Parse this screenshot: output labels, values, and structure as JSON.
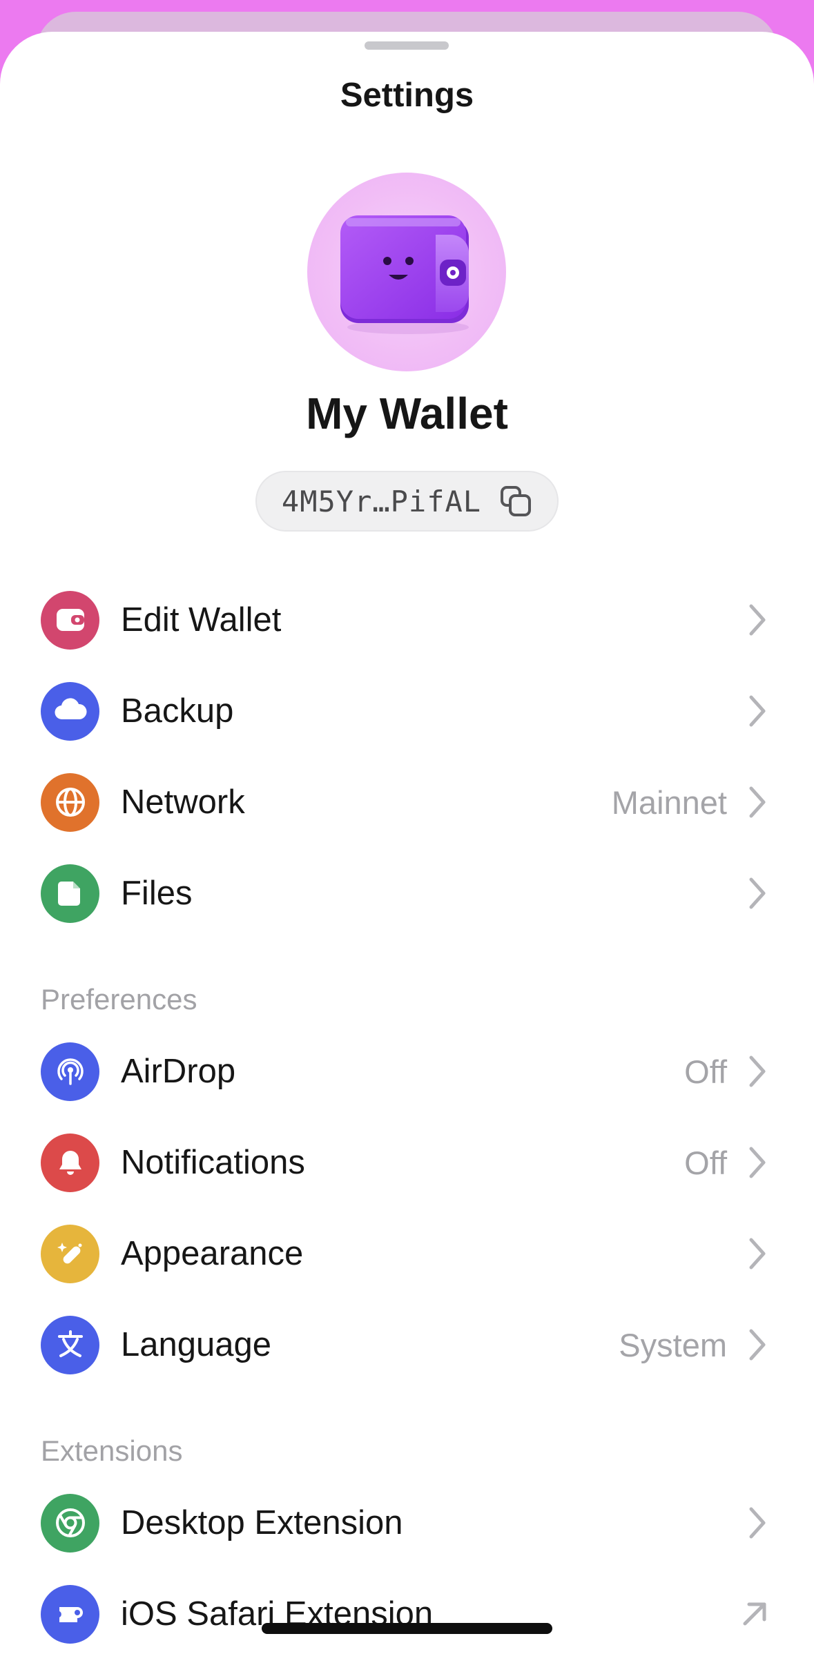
{
  "header": {
    "title": "Settings"
  },
  "profile": {
    "name": "My Wallet",
    "address": "4M5Yr…PifAL",
    "avatar_icon": "wallet-mascot-icon",
    "copy_icon": "copy-icon"
  },
  "colors": {
    "background": "#ec7af0",
    "sheet": "#ffffff",
    "accent_purple": "#9a3cf0"
  },
  "wallet_section": {
    "items": [
      {
        "label": "Edit Wallet",
        "value": "",
        "icon": "wallet-icon",
        "color": "#d2466e"
      },
      {
        "label": "Backup",
        "value": "",
        "icon": "cloud-icon",
        "color": "#4a5fe8"
      },
      {
        "label": "Network",
        "value": "Mainnet",
        "icon": "globe-icon",
        "color": "#e0722c"
      },
      {
        "label": "Files",
        "value": "",
        "icon": "file-icon",
        "color": "#3fa462"
      }
    ]
  },
  "preferences": {
    "heading": "Preferences",
    "items": [
      {
        "label": "AirDrop",
        "value": "Off",
        "icon": "airdrop-icon",
        "color": "#4a5fe8"
      },
      {
        "label": "Notifications",
        "value": "Off",
        "icon": "bell-icon",
        "color": "#dc4a4a"
      },
      {
        "label": "Appearance",
        "value": "",
        "icon": "magic-wand-icon",
        "color": "#e6b53c"
      },
      {
        "label": "Language",
        "value": "System",
        "icon": "translate-icon",
        "color": "#4a5fe8"
      }
    ]
  },
  "extensions": {
    "heading": "Extensions",
    "items": [
      {
        "label": "Desktop Extension",
        "value": "",
        "icon": "chrome-icon",
        "color": "#3fa462",
        "action_icon": "chevron-right-icon"
      },
      {
        "label": "iOS Safari Extension",
        "value": "",
        "icon": "puzzle-icon",
        "color": "#4a5fe8",
        "action_icon": "arrow-up-right-icon"
      }
    ]
  }
}
